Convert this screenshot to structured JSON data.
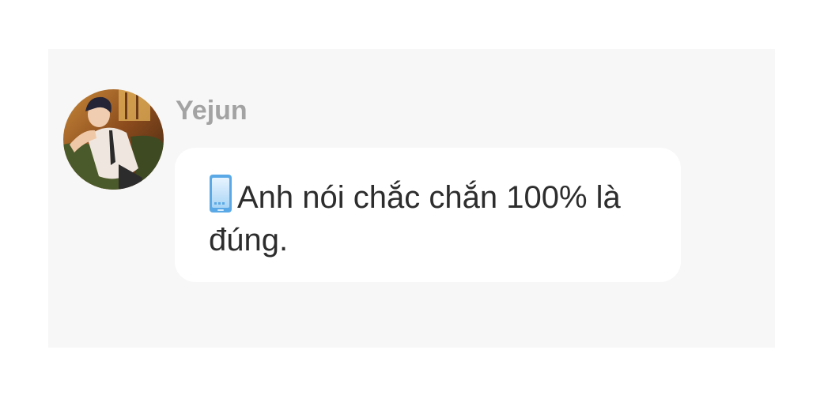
{
  "message": {
    "sender": "Yejun",
    "text": "Anh nói chắc chắn 100% là đúng.",
    "leading_icon": "mobile-phone-icon",
    "avatar_icon": "avatar-portrait"
  },
  "colors": {
    "page_background": "#ffffff",
    "panel_background": "#f7f7f7",
    "bubble_background": "#ffffff",
    "sender_name": "#a3a3a3",
    "message_text": "#2d2d2d",
    "phone_icon": "#5aa9e6"
  }
}
